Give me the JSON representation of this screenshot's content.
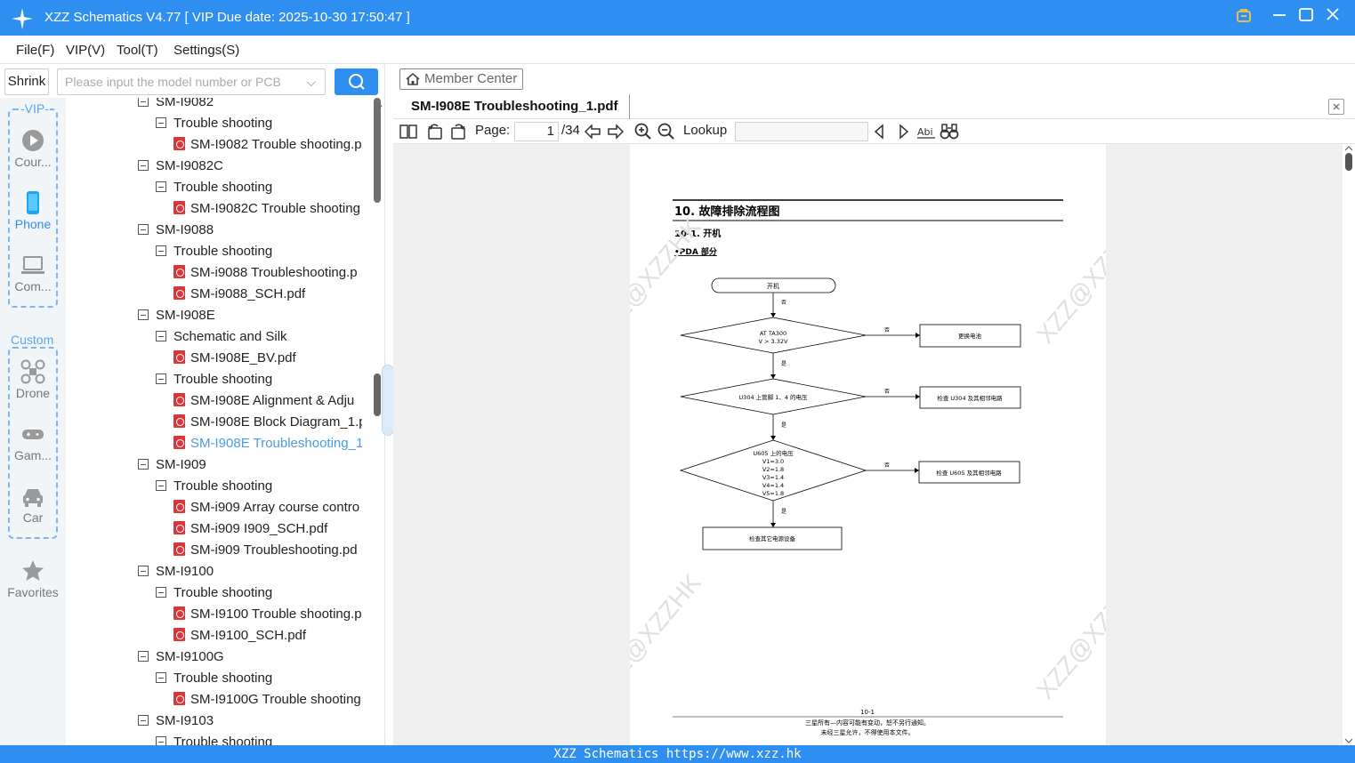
{
  "app": {
    "title": "XZZ Schematics V4.77 [ VIP Due date: 2025-10-30 17:50:47 ]"
  },
  "menu": [
    "File(F)",
    "VIP(V)",
    "Tool(T)",
    "Settings(S)"
  ],
  "search": {
    "shrink_label": "Shrink",
    "placeholder": "Please input the model number or PCB"
  },
  "rail": {
    "vip_label": "-VIP-",
    "custom_label": "Custom",
    "items": [
      "Cour...",
      "Phone",
      "Com...",
      "Drone",
      "Gam...",
      "Car",
      "Favorites"
    ]
  },
  "tree": [
    {
      "level": 0,
      "label": "SM-I9082",
      "kind": "folder"
    },
    {
      "level": 1,
      "label": "Trouble shooting",
      "kind": "folder"
    },
    {
      "level": 2,
      "label": "SM-I9082 Trouble shooting.p",
      "kind": "pdf"
    },
    {
      "level": 0,
      "label": "SM-I9082C",
      "kind": "folder"
    },
    {
      "level": 1,
      "label": "Trouble shooting",
      "kind": "folder"
    },
    {
      "level": 2,
      "label": "SM-I9082C Trouble shooting",
      "kind": "pdf"
    },
    {
      "level": 0,
      "label": "SM-I9088",
      "kind": "folder"
    },
    {
      "level": 1,
      "label": "Trouble shooting",
      "kind": "folder"
    },
    {
      "level": 2,
      "label": "SM-i9088 Troubleshooting.p",
      "kind": "pdf"
    },
    {
      "level": 2,
      "label": "SM-i9088_SCH.pdf",
      "kind": "pdf"
    },
    {
      "level": 0,
      "label": "SM-I908E",
      "kind": "folder"
    },
    {
      "level": 1,
      "label": "Schematic and Silk",
      "kind": "folder"
    },
    {
      "level": 2,
      "label": "SM-I908E_BV.pdf",
      "kind": "pdf"
    },
    {
      "level": 1,
      "label": "Trouble shooting",
      "kind": "folder"
    },
    {
      "level": 2,
      "label": "SM-I908E Alignment & Adju",
      "kind": "pdf"
    },
    {
      "level": 2,
      "label": "SM-I908E Block Diagram_1.p",
      "kind": "pdf"
    },
    {
      "level": 2,
      "label": "SM-I908E Troubleshooting_1",
      "kind": "pdf",
      "selected": true
    },
    {
      "level": 0,
      "label": "SM-I909",
      "kind": "folder"
    },
    {
      "level": 1,
      "label": "Trouble shooting",
      "kind": "folder"
    },
    {
      "level": 2,
      "label": "SM-i909 Array course contro",
      "kind": "pdf"
    },
    {
      "level": 2,
      "label": "SM-i909 I909_SCH.pdf",
      "kind": "pdf"
    },
    {
      "level": 2,
      "label": "SM-i909 Troubleshooting.pd",
      "kind": "pdf"
    },
    {
      "level": 0,
      "label": "SM-I9100",
      "kind": "folder"
    },
    {
      "level": 1,
      "label": "Trouble shooting",
      "kind": "folder"
    },
    {
      "level": 2,
      "label": "SM-I9100 Trouble shooting.p",
      "kind": "pdf"
    },
    {
      "level": 2,
      "label": "SM-I9100_SCH.pdf",
      "kind": "pdf"
    },
    {
      "level": 0,
      "label": "SM-I9100G",
      "kind": "folder"
    },
    {
      "level": 1,
      "label": "Trouble shooting",
      "kind": "folder"
    },
    {
      "level": 2,
      "label": "SM-I9100G Trouble shooting",
      "kind": "pdf"
    },
    {
      "level": 0,
      "label": "SM-I9103",
      "kind": "folder"
    },
    {
      "level": 1,
      "label": "Trouble shooting",
      "kind": "folder"
    }
  ],
  "viewer": {
    "member_center": "Member Center",
    "tab_title": "SM-I908E Troubleshooting_1.pdf",
    "page_label": "Page:",
    "page_current": "1",
    "page_total": "/34",
    "lookup_label": "Lookup"
  },
  "document": {
    "heading": "10. 故障排除流程图",
    "subheading": "10-1. 开机",
    "section": "•PDA 部分",
    "start": "开机",
    "no": "否",
    "yes": "是",
    "d1_lines": [
      "AT TA300",
      "V > 3.32V"
    ],
    "d2": "U304 上管脚 1、4 的电压",
    "d3_lines": [
      "U605 上的电压",
      "V1=3.0",
      "V2=1.8",
      "V3=1.4",
      "V4=1.4",
      "V5=1.8"
    ],
    "r1": "更换电池",
    "r2": "检查 U304 及其相邻电路",
    "r3": "检查 U605 及其相邻电路",
    "end": "检查其它电源设备",
    "page_no": "10-1",
    "foot1": "三星所有—内容可能有变动，恕不另行通知。",
    "foot2": "未经三星允许，不得使用本文件。",
    "watermark": "XZZ@XZZHK"
  },
  "footer": "XZZ Schematics https://www.xzz.hk",
  "colors": {
    "accent": "#2f8ff0",
    "selected": "#4a9ae8",
    "pdf": "#d9363e"
  }
}
